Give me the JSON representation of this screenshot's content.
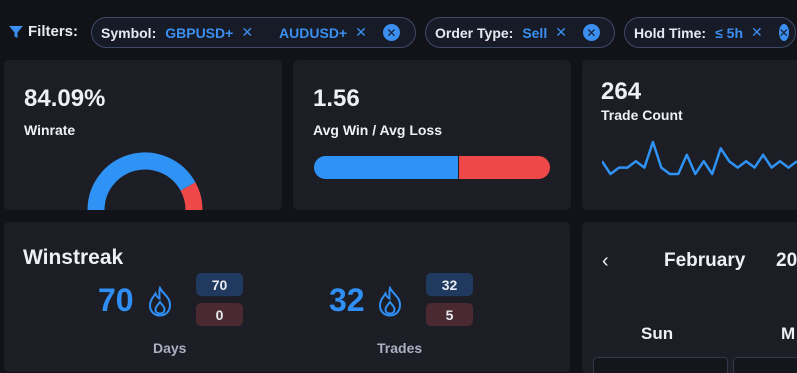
{
  "filters": {
    "label": "Filters:",
    "chips": [
      {
        "key": "Symbol:",
        "values": [
          "GBPUSD+",
          "AUDUSD+"
        ]
      },
      {
        "key": "Order Type:",
        "values": [
          "Sell"
        ]
      },
      {
        "key": "Hold Time:",
        "values": [
          "≤ 5h"
        ]
      }
    ]
  },
  "winrate": {
    "value": "84.09%",
    "label": "Winrate",
    "fraction": 0.8409
  },
  "avg_win_loss": {
    "value": "1.56",
    "label": "Avg Win / Avg Loss",
    "win_fraction": 0.61
  },
  "trade_count": {
    "value": "264",
    "label": "Trade Count",
    "sparkline": [
      3,
      1,
      2,
      2,
      3,
      2,
      6,
      2,
      1,
      1,
      4,
      1,
      3,
      1,
      5,
      3,
      2,
      3,
      2,
      4,
      2,
      3,
      2,
      3
    ]
  },
  "winstreak": {
    "title": "Winstreak",
    "days": {
      "value": "70",
      "best": "70",
      "worst": "0",
      "label": "Days"
    },
    "trades": {
      "value": "32",
      "best": "32",
      "worst": "5",
      "label": "Trades"
    }
  },
  "calendar": {
    "prev_label": "‹",
    "month": "February",
    "year": "20",
    "days": [
      "Sun",
      "M"
    ]
  },
  "colors": {
    "accent": "#2f93f5",
    "loss": "#ef4848",
    "card": "#1c1d25",
    "bg": "#121219"
  }
}
